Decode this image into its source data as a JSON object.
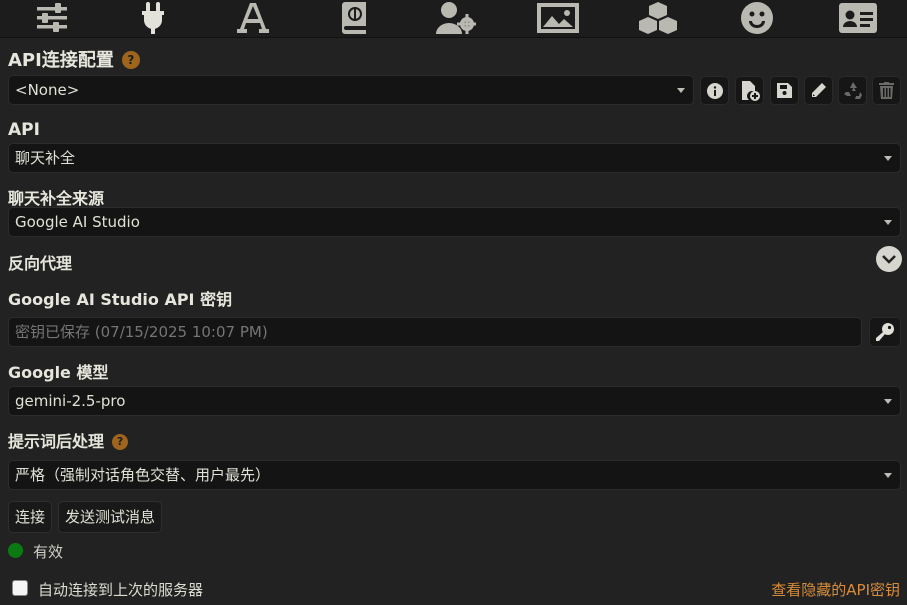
{
  "nav": {
    "tabs": [
      {
        "icon": "sliders-icon"
      },
      {
        "icon": "plug-icon"
      },
      {
        "icon": "font-icon"
      },
      {
        "icon": "book-atlas-icon"
      },
      {
        "icon": "user-gear-icon"
      },
      {
        "icon": "image-icon"
      },
      {
        "icon": "cubes-icon"
      },
      {
        "icon": "smile-icon"
      },
      {
        "icon": "id-card-icon"
      }
    ],
    "active_tab": "plug-icon"
  },
  "connection_profile": {
    "label": "API连接配置",
    "help": "?",
    "selected": "<None>",
    "actions": [
      "info-icon",
      "file-plus-icon",
      "save-icon",
      "pencil-icon",
      "recycle-icon",
      "trash-icon"
    ]
  },
  "api": {
    "label": "API",
    "selected": "聊天补全"
  },
  "chat_source": {
    "label": "聊天补全来源",
    "selected": "Google AI Studio"
  },
  "reverse_proxy": {
    "label": "反向代理"
  },
  "api_key": {
    "label": "Google AI Studio API 密钥",
    "placeholder": "密钥已保存 (07/15/2025 10:07 PM)"
  },
  "model": {
    "label": "Google 模型",
    "selected": "gemini-2.5-pro"
  },
  "post_processing": {
    "label": "提示词后处理",
    "help": "?",
    "selected": "严格（强制对话角色交替、用户最先）"
  },
  "buttons": {
    "connect": "连接",
    "send_test": "发送测试消息"
  },
  "status": {
    "text": "有效",
    "color": "#0c7a12"
  },
  "auto_connect": {
    "label": "自动连接到上次的服务器",
    "checked": false
  },
  "hidden_keys_link": "查看隐藏的API密钥",
  "colors": {
    "background": "#222222",
    "accent": "#d88d3a",
    "help_badge": "#a0651c"
  }
}
